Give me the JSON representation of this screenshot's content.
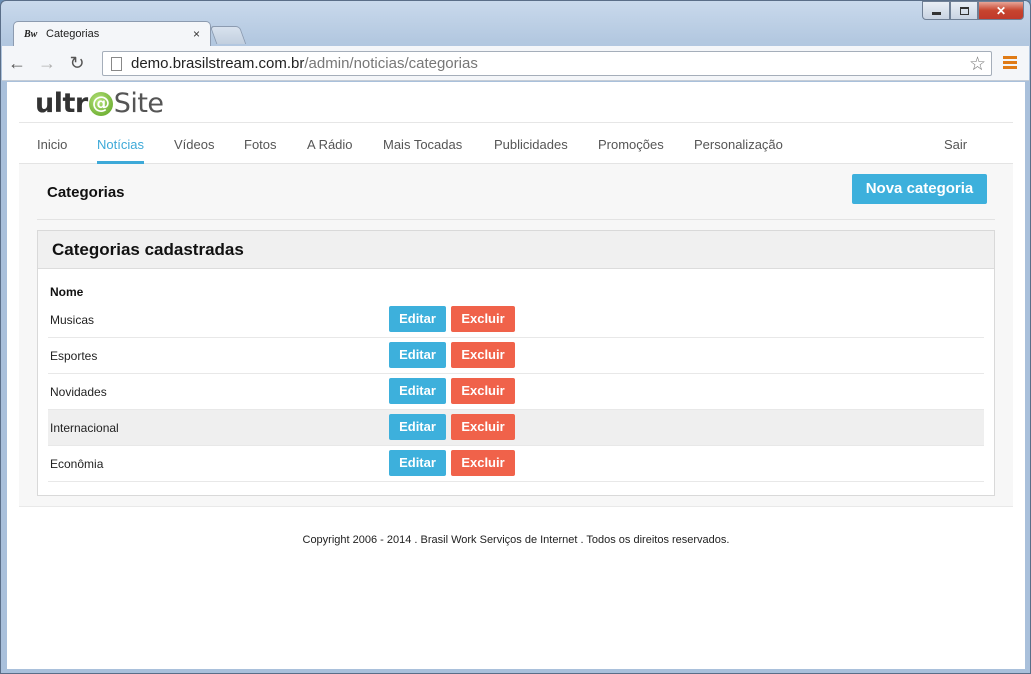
{
  "browser": {
    "tab_title": "Categorias",
    "tab_favicon": "Bw",
    "tab_close": "×",
    "url_host": "demo.brasilstream.com.br",
    "url_path": "/admin/noticias/categorias",
    "back_glyph": "←",
    "forward_glyph": "→",
    "reload_glyph": "↻",
    "star_glyph": "☆",
    "close_glyph": "✕",
    "menu_color": "#e07b16"
  },
  "logo": {
    "part1": "ultr",
    "at": "@",
    "part2": "Site"
  },
  "nav": {
    "items": [
      {
        "label": "Inicio"
      },
      {
        "label": "Notícias",
        "active": true
      },
      {
        "label": "Vídeos"
      },
      {
        "label": "Fotos"
      },
      {
        "label": "A Rádio"
      },
      {
        "label": "Mais Tocadas"
      },
      {
        "label": "Publicidades"
      },
      {
        "label": "Promoções"
      },
      {
        "label": "Personalização"
      }
    ],
    "logout": "Sair"
  },
  "header": {
    "title": "Categorias",
    "new_button": "Nova categoria"
  },
  "panel": {
    "title": "Categorias cadastradas",
    "column_name": "Nome",
    "edit_label": "Editar",
    "delete_label": "Excluir",
    "rows": [
      {
        "name": "Musicas"
      },
      {
        "name": "Esportes"
      },
      {
        "name": "Novidades"
      },
      {
        "name": "Internacional"
      },
      {
        "name": "Econômia"
      }
    ]
  },
  "footer": {
    "text": "Copyright 2006 - 2014 . Brasil Work Serviços de Internet . Todos os direitos reservados."
  },
  "colors": {
    "primary": "#3db0dc",
    "danger": "#f0624a",
    "nav_active": "#3da9d8"
  }
}
